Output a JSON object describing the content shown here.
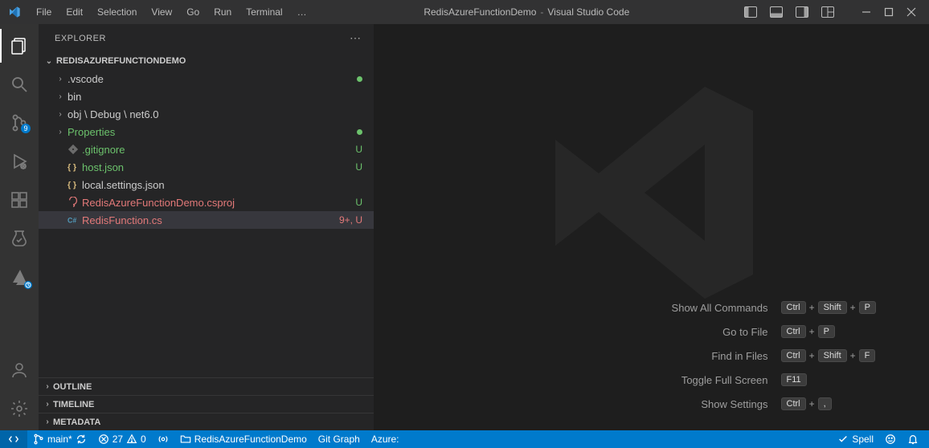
{
  "titlebar": {
    "menus": [
      "File",
      "Edit",
      "Selection",
      "View",
      "Go",
      "Run",
      "Terminal",
      "…"
    ],
    "project": "RedisAzureFunctionDemo",
    "app_name": "Visual Studio Code"
  },
  "sidebar": {
    "title": "EXPLORER",
    "workspace": "REDISAZUREFUNCTIONDEMO",
    "tree": [
      {
        "kind": "folder",
        "name": ".vscode",
        "depth": 1,
        "decor_dot": true
      },
      {
        "kind": "folder",
        "name": "bin",
        "depth": 1
      },
      {
        "kind": "folder",
        "name": "obj \\ Debug \\ net6.0",
        "depth": 1
      },
      {
        "kind": "folder",
        "name": "Properties",
        "depth": 1,
        "decor_dot": true,
        "name_color": "green"
      },
      {
        "kind": "file",
        "name": ".gitignore",
        "depth": 1,
        "icon": "gitignore",
        "name_color": "green",
        "decor_text": "U",
        "decor_color": "green"
      },
      {
        "kind": "file",
        "name": "host.json",
        "depth": 1,
        "icon": "json",
        "name_color": "green",
        "decor_text": "U",
        "decor_color": "green"
      },
      {
        "kind": "file",
        "name": "local.settings.json",
        "depth": 1,
        "icon": "json"
      },
      {
        "kind": "file",
        "name": "RedisAzureFunctionDemo.csproj",
        "depth": 1,
        "icon": "csproj",
        "name_color": "red",
        "decor_text": "U",
        "decor_color": "green"
      },
      {
        "kind": "file",
        "name": "RedisFunction.cs",
        "depth": 1,
        "icon": "cs",
        "name_color": "red",
        "decor_text": "9+, U",
        "decor_color": "red",
        "selected": true
      }
    ],
    "sections": [
      "OUTLINE",
      "TIMELINE",
      "METADATA"
    ]
  },
  "activitybar": {
    "scm_badge": "9"
  },
  "welcome": {
    "shortcuts": [
      {
        "label": "Show All Commands",
        "keys": [
          "Ctrl",
          "+",
          "Shift",
          "+",
          "P"
        ]
      },
      {
        "label": "Go to File",
        "keys": [
          "Ctrl",
          "+",
          "P"
        ]
      },
      {
        "label": "Find in Files",
        "keys": [
          "Ctrl",
          "+",
          "Shift",
          "+",
          "F"
        ]
      },
      {
        "label": "Toggle Full Screen",
        "keys": [
          "F11"
        ]
      },
      {
        "label": "Show Settings",
        "keys": [
          "Ctrl",
          "+",
          ","
        ]
      }
    ]
  },
  "statusbar": {
    "branch": "main*",
    "sync_icon": true,
    "errors": "27",
    "warnings": "0",
    "port_forward_icon": true,
    "folder_label": "RedisAzureFunctionDemo",
    "git_graph": "Git Graph",
    "azure": "Azure:",
    "right_spell": "Spell",
    "right_feedback_icon": true,
    "right_bell_icon": true
  }
}
